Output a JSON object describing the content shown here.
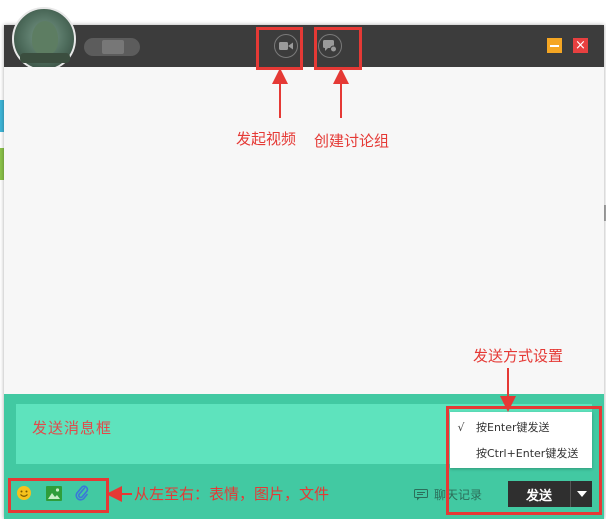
{
  "window": {
    "close_symbol": "×"
  },
  "titlebar": {
    "icons": [
      "video-call-icon",
      "group-discussion-icon"
    ]
  },
  "composer": {
    "placeholder": "发送消息框",
    "send_menu": {
      "items": [
        {
          "check": "√",
          "label": "按Enter键发送",
          "selected": true
        },
        {
          "check": "",
          "label": "按Ctrl+Enter键发送",
          "selected": false
        }
      ]
    },
    "toolbar_icons": [
      "emoji-icon",
      "image-icon",
      "attach-file-icon"
    ],
    "history_label": "聊天记录",
    "send_label": "发送"
  },
  "annotations": {
    "video": "发起视频",
    "group": "创建讨论组",
    "send_mode": "发送方式设置",
    "tools": "从左至右：表情，图片，文件"
  },
  "colors": {
    "titlebar": "#3c3c3c",
    "composer": "#42c9a2",
    "input": "#5ee3bd",
    "annotation": "#e53935",
    "minimize": "#f5a623",
    "close": "#e84040"
  }
}
